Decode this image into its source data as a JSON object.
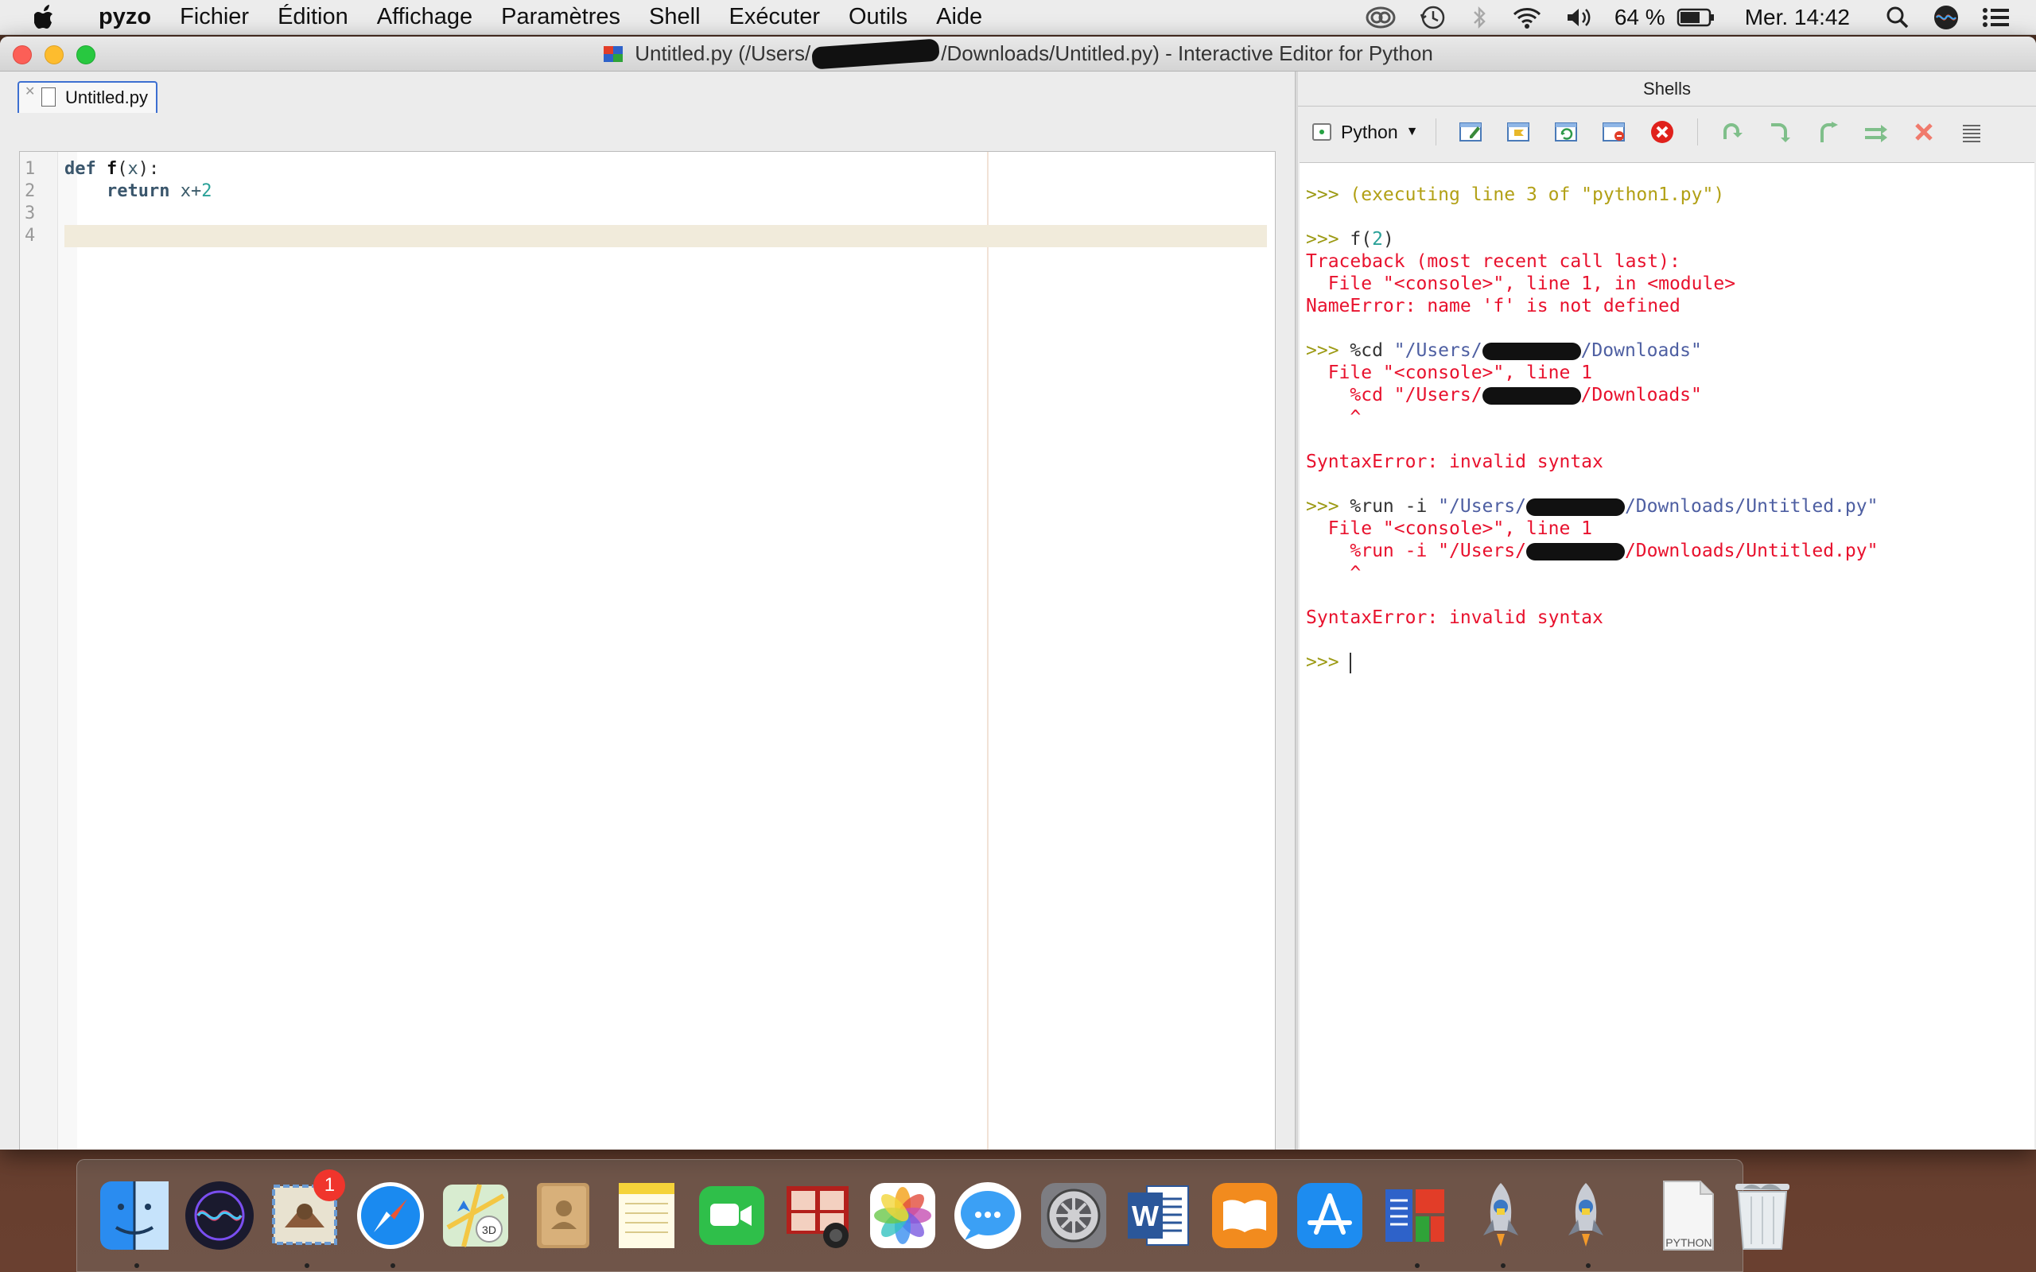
{
  "menubar": {
    "app": "pyzo",
    "items": [
      "Fichier",
      "Édition",
      "Affichage",
      "Paramètres",
      "Shell",
      "Exécuter",
      "Outils",
      "Aide"
    ],
    "battery": "64 %",
    "clock": "Mer. 14:42"
  },
  "window": {
    "title_prefix": "Untitled.py (/Users/",
    "title_suffix": "/Downloads/Untitled.py) - Interactive Editor for Python"
  },
  "editor": {
    "tab_label": "Untitled.py",
    "line_numbers": [
      "1",
      "2",
      "3",
      "4"
    ]
  },
  "shells": {
    "title": "Shells",
    "shell_name": "Python"
  },
  "colors": {
    "accent": "#3d6fd1",
    "error": "#e8112d",
    "prompt": "#9c9a14"
  },
  "dock": {
    "mail_badge": "1",
    "doc_label": "PYTHON"
  }
}
